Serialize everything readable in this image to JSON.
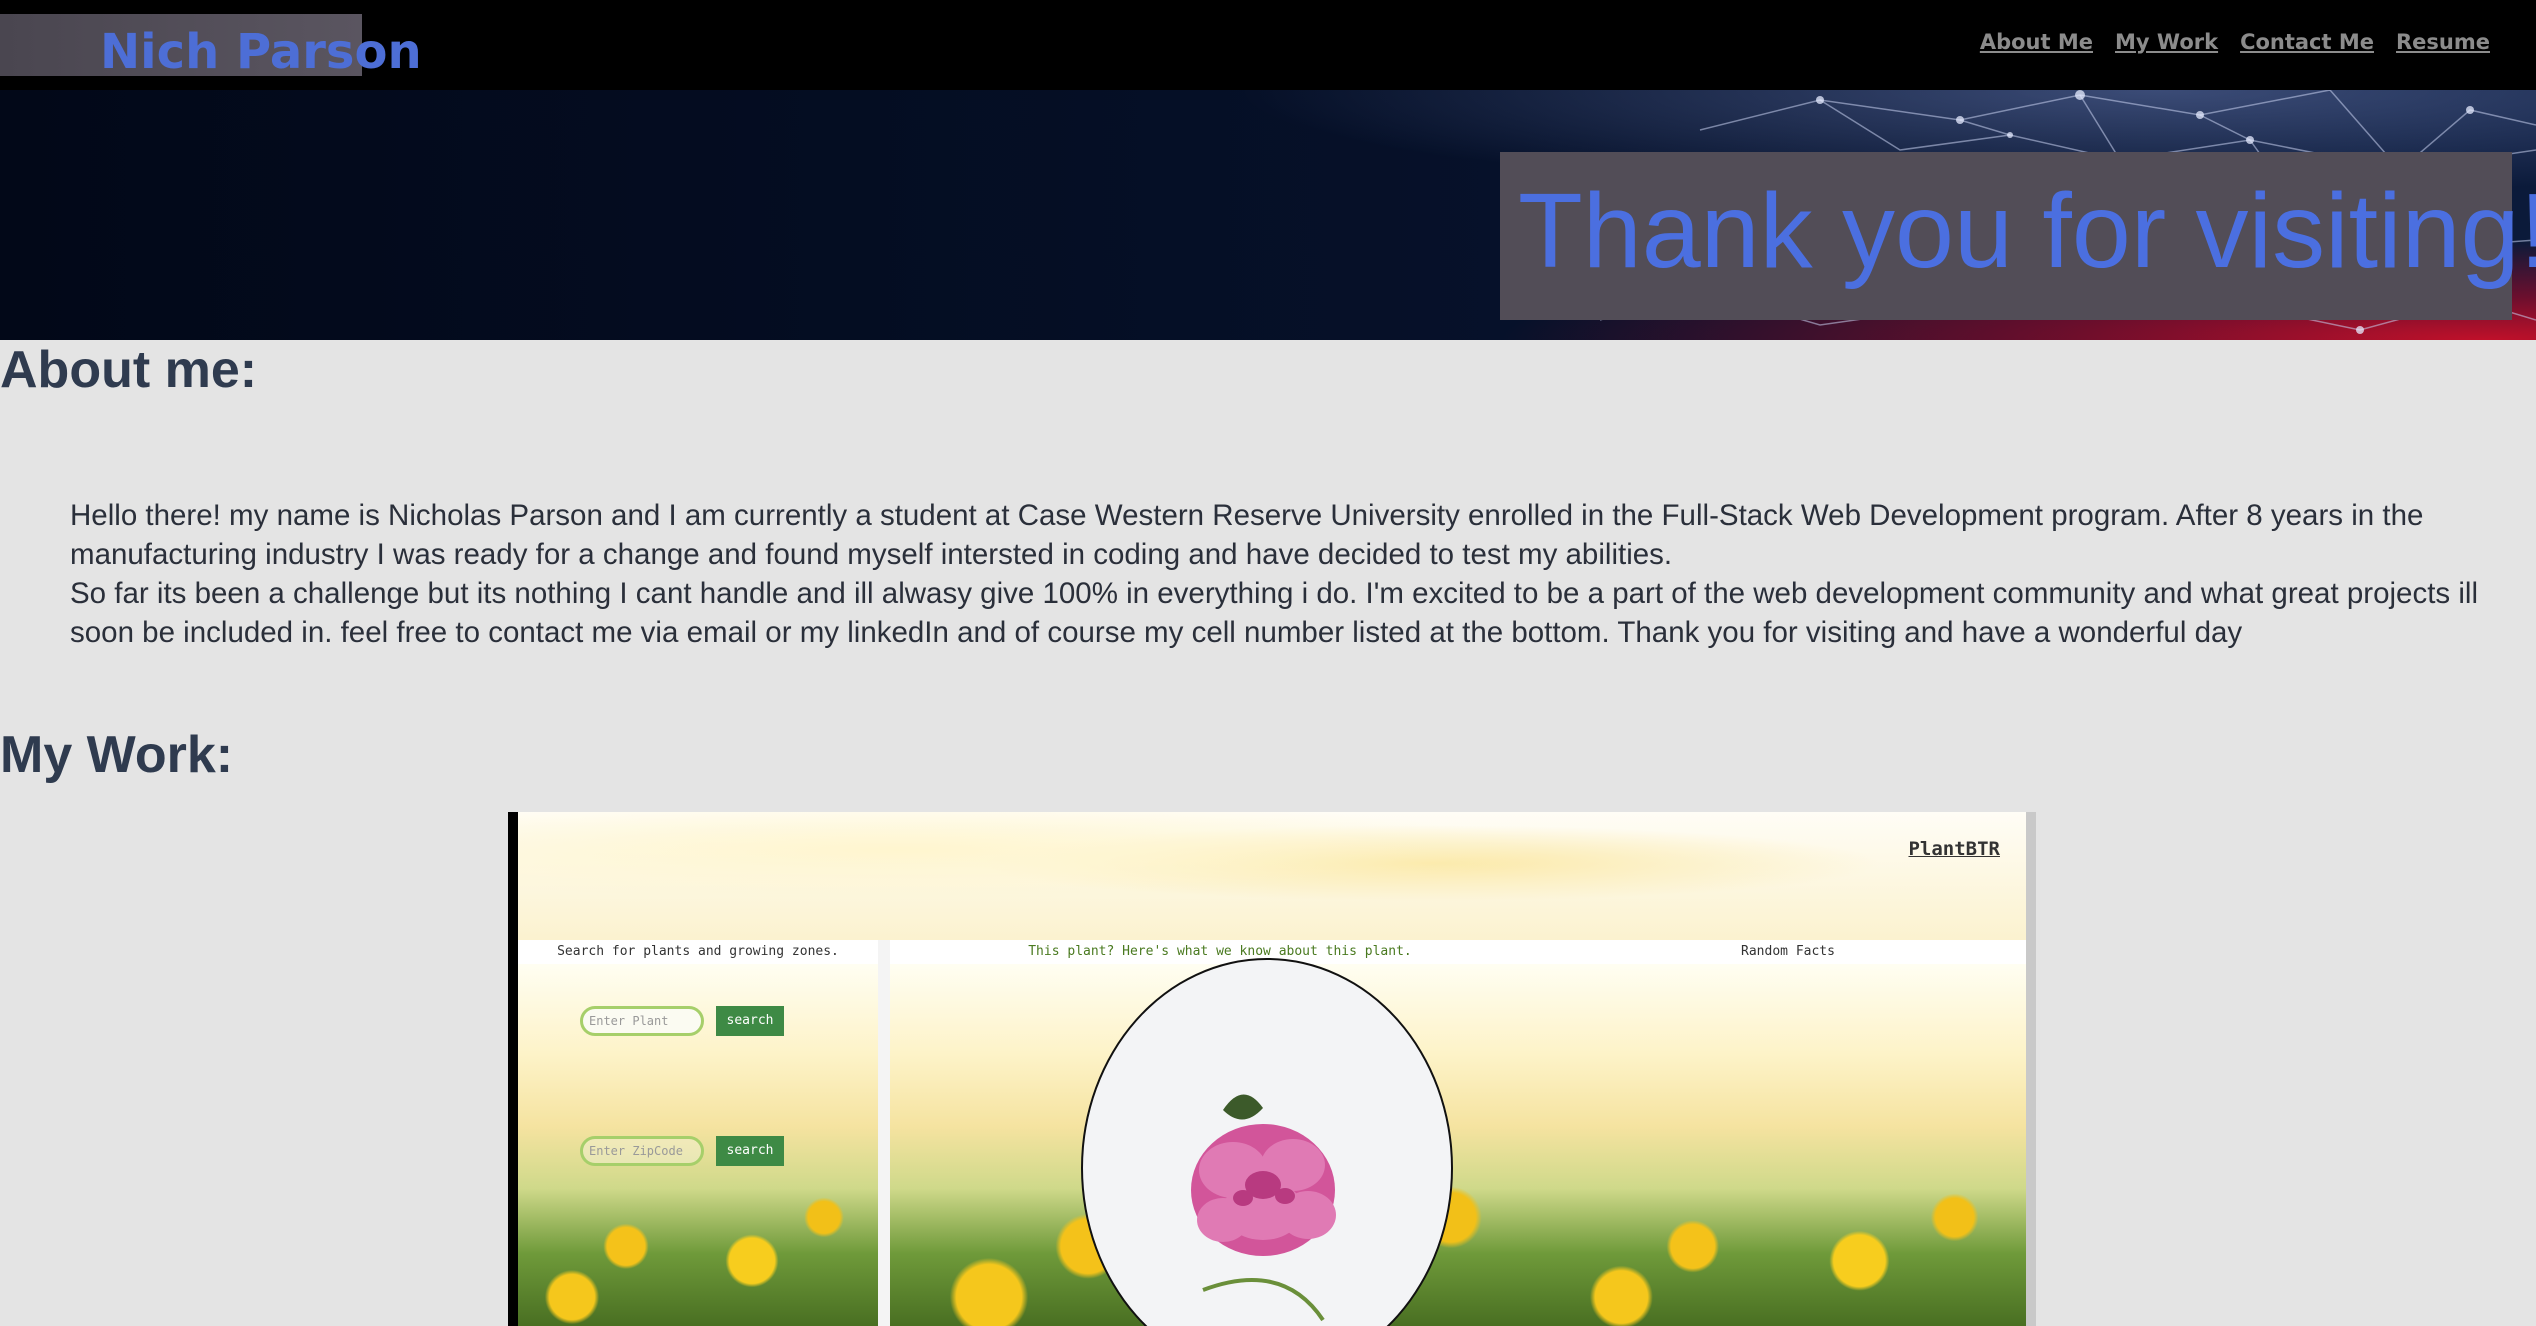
{
  "header": {
    "brand": "Nich Parson",
    "nav": [
      "About Me",
      "My Work",
      "Contact Me",
      "Resume"
    ]
  },
  "hero": {
    "title": "Thank you for visiting!"
  },
  "about": {
    "heading": "About me:",
    "paragraph1": "Hello there! my name is Nicholas Parson and I am currently a student at Case Western Reserve University enrolled in the Full-Stack Web Development program. After 8 years in the manufacturing industry I was ready for a change and found myself intersted in coding and have decided to test my abilities.",
    "paragraph2": "So far its been a challenge but its nothing I cant handle and ill alwasy give 100% in everything i do. I'm excited to be a part of the web development community and what great projects ill soon be included in. feel free to contact me via email or my linkedIn and of course my cell number listed at the bottom. Thank you for visiting and have a wonderful day"
  },
  "work": {
    "heading": "My Work:",
    "project": {
      "site_name": "PlantBTR",
      "left_title": "Search for plants and growing zones.",
      "plant_placeholder": "Enter Plant",
      "zip_placeholder": "Enter ZipCode",
      "search_label": "search",
      "center_title": "This plant? Here's what we know about this plant.",
      "right_title": "Random Facts"
    }
  },
  "colors": {
    "brand_blue": "#4d6ed6",
    "hero_box": "#524d57",
    "heading": "#2f3b4f",
    "page_bg": "#e4e4e4"
  }
}
